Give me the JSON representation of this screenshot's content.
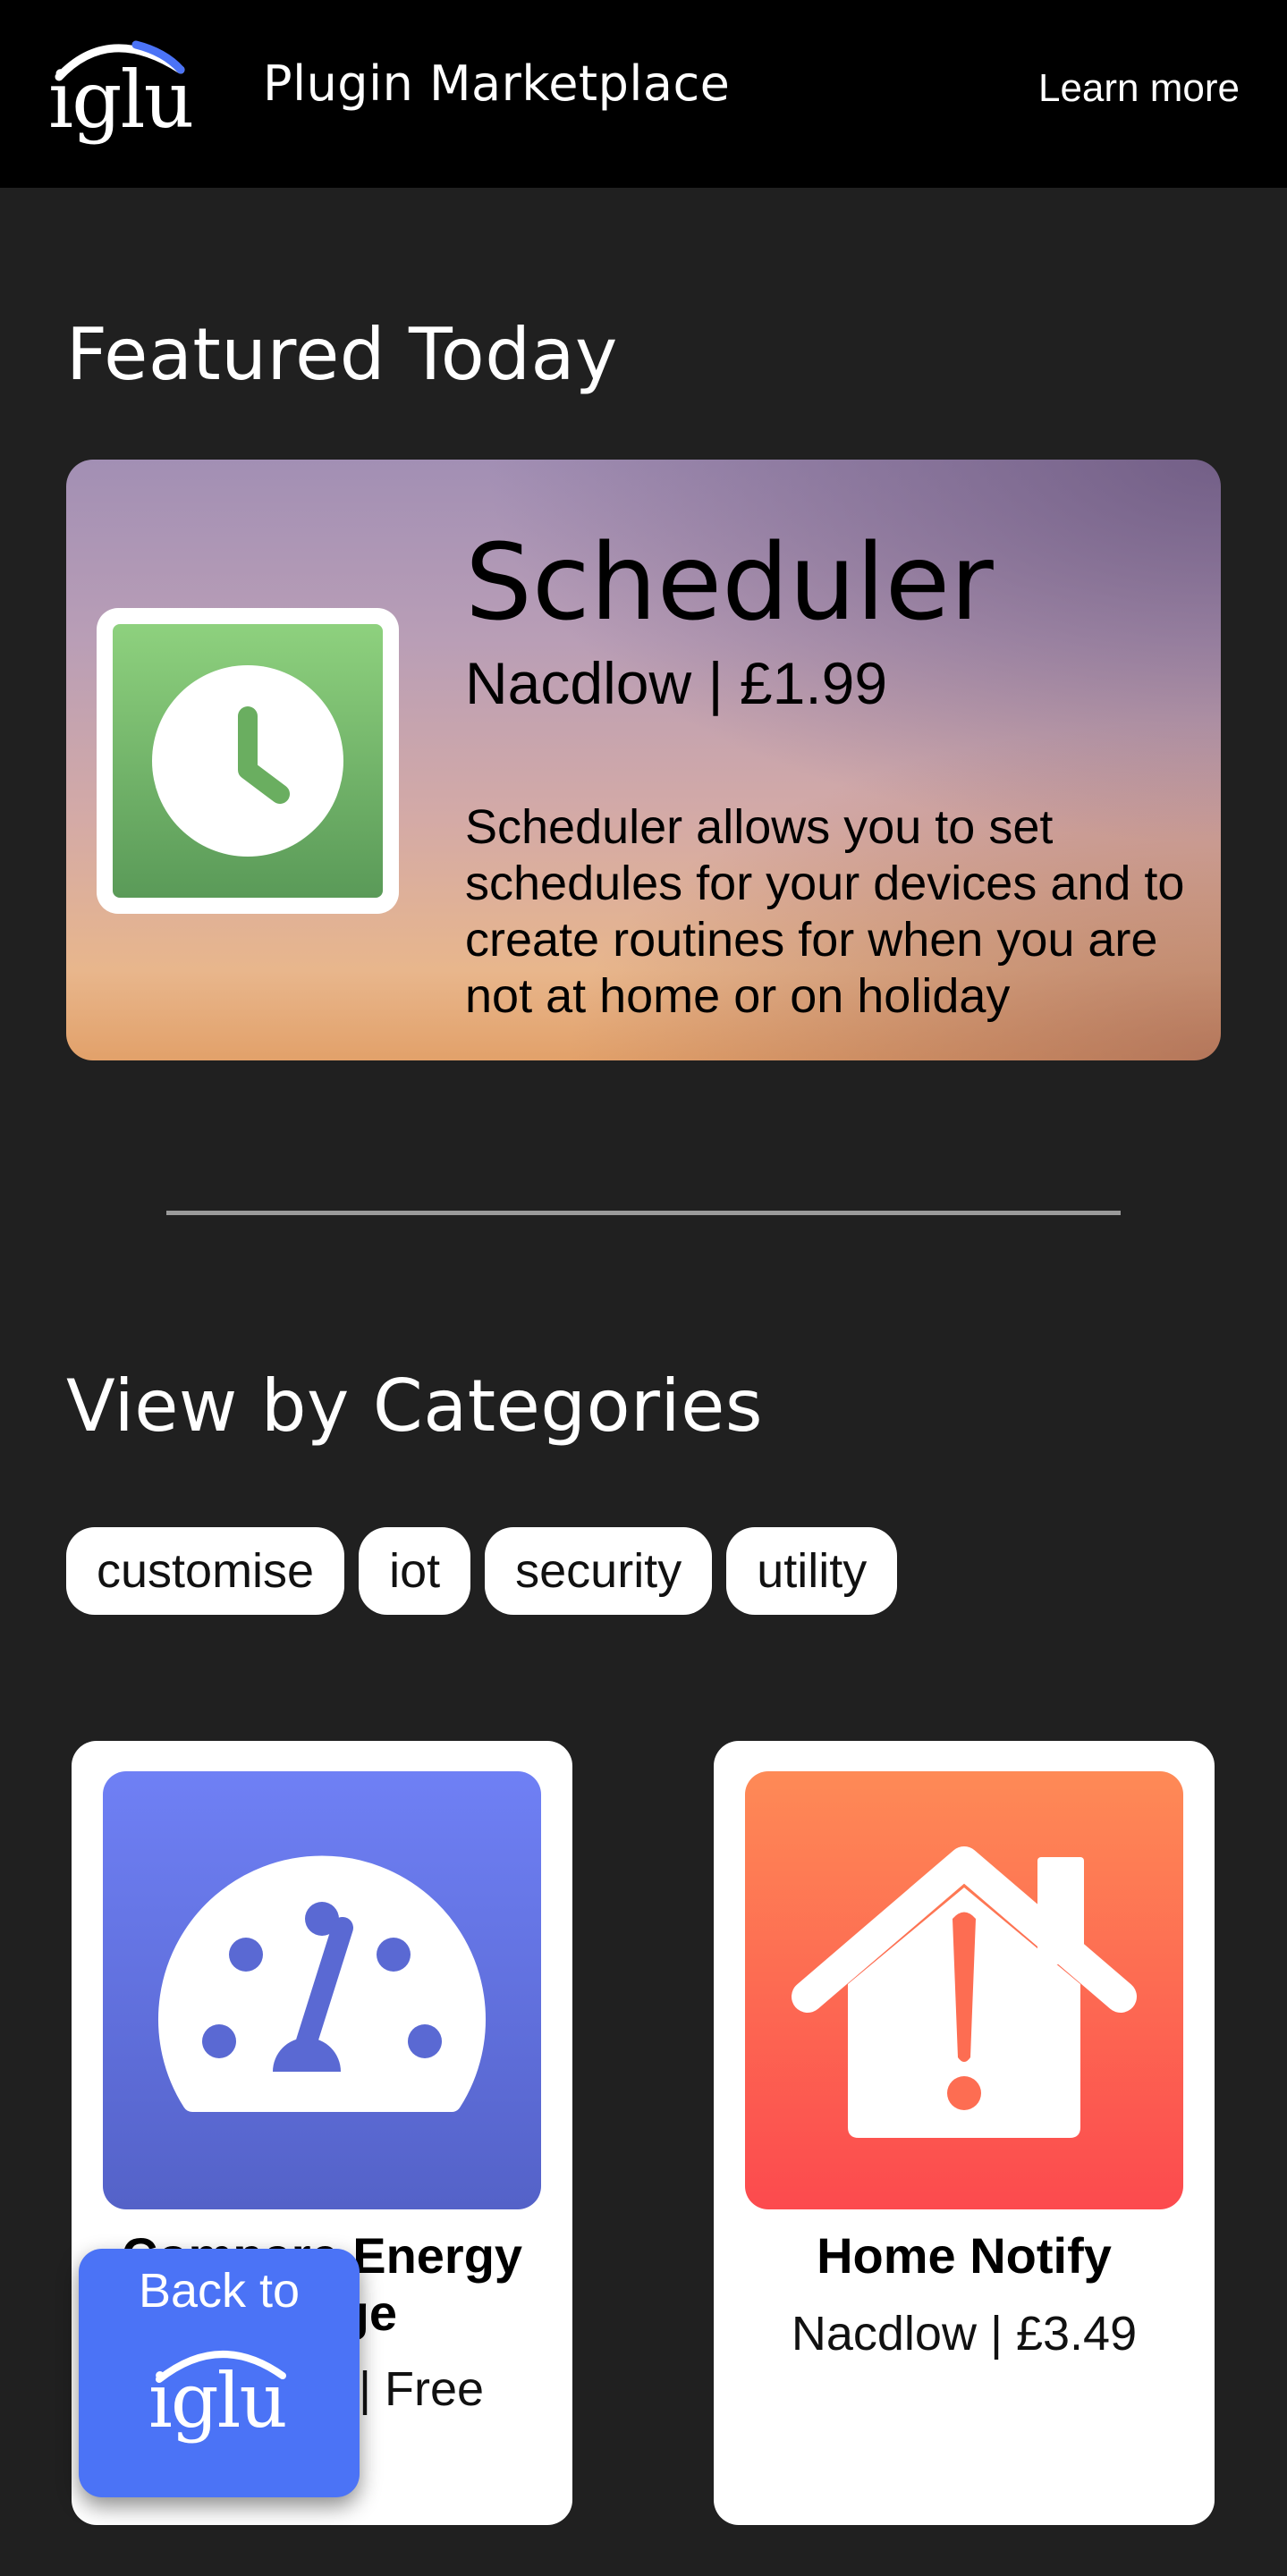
{
  "header": {
    "logo_text": "iglu",
    "title": "Plugin Marketplace",
    "learn_more": "Learn more"
  },
  "featured": {
    "section_title": "Featured Today",
    "name": "Scheduler",
    "meta": "Nacdlow | £1.99",
    "description": "Scheduler allows you to set schedules for your devices and to create routines for when you are not at home or on holiday",
    "icon": "clock-icon",
    "icon_color": "#6fb566"
  },
  "categories": {
    "section_title": "View by Categories",
    "chips": [
      "customise",
      "iot",
      "security",
      "utility"
    ]
  },
  "plugins": [
    {
      "name": "Compare Energy Usage",
      "meta": "Nacdlow | Free",
      "icon": "speedometer-icon",
      "icon_gradient": [
        "#6f80f5",
        "#5462c8"
      ]
    },
    {
      "name": "Home Notify",
      "meta": "Nacdlow | £3.49",
      "icon": "home-alert-icon",
      "icon_gradient": [
        "#fe8a56",
        "#fc4a4e"
      ]
    }
  ],
  "back_button": {
    "label": "Back to",
    "logo_text": "iglu",
    "color": "#4b73f6"
  },
  "colors": {
    "background": "#202020",
    "topbar": "#000000",
    "accent": "#4b73f6"
  }
}
